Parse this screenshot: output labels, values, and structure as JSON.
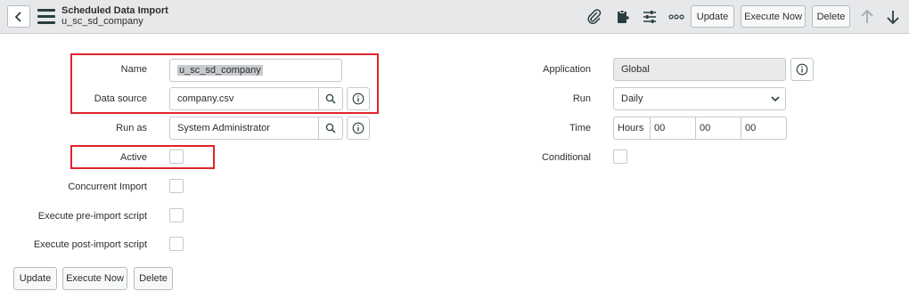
{
  "header": {
    "title": "Scheduled Data Import",
    "subtitle": "u_sc_sd_company",
    "buttons": {
      "update": "Update",
      "execute_now": "Execute Now",
      "delete": "Delete"
    }
  },
  "form": {
    "name": {
      "label": "Name",
      "value": "u_sc_sd_company"
    },
    "data_source": {
      "label": "Data source",
      "value": "company.csv"
    },
    "run_as": {
      "label": "Run as",
      "value": "System Administrator"
    },
    "active": {
      "label": "Active",
      "checked": false
    },
    "concurrent_import": {
      "label": "Concurrent Import",
      "checked": false
    },
    "pre_import": {
      "label": "Execute pre-import script",
      "checked": false
    },
    "post_import": {
      "label": "Execute post-import script",
      "checked": false
    },
    "application": {
      "label": "Application",
      "value": "Global"
    },
    "run": {
      "label": "Run",
      "value": "Daily"
    },
    "time": {
      "label": "Time",
      "unit": "Hours",
      "hours": "00",
      "minutes": "00",
      "seconds": "00"
    },
    "conditional": {
      "label": "Conditional",
      "checked": false
    }
  },
  "footer": {
    "update": "Update",
    "execute_now": "Execute Now",
    "delete": "Delete"
  },
  "colors": {
    "highlight": "#e0242a",
    "header_bg": "#e6e8ea"
  }
}
